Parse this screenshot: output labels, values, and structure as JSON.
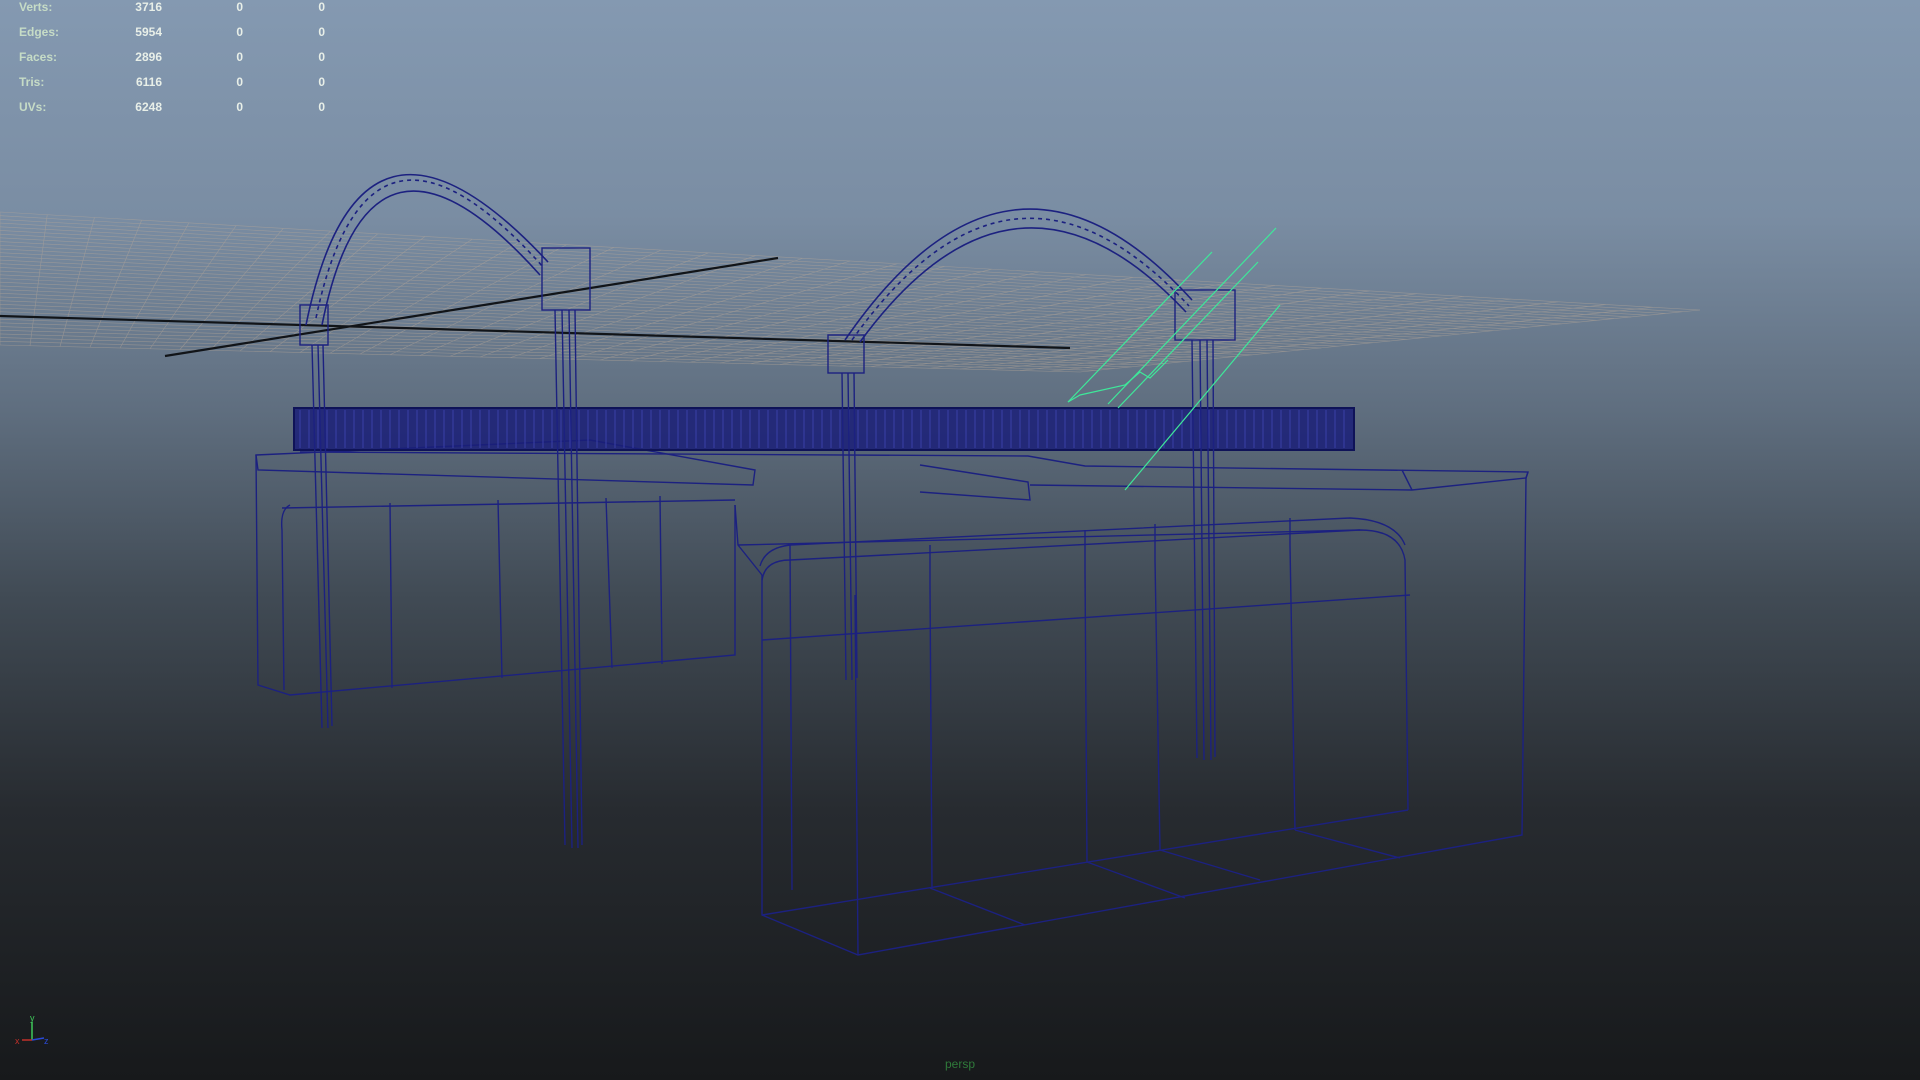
{
  "heads_up_display": {
    "poly_count": [
      {
        "label": "Verts:",
        "values": [
          "3716",
          "0",
          "0"
        ]
      },
      {
        "label": "Edges:",
        "values": [
          "5954",
          "0",
          "0"
        ]
      },
      {
        "label": "Faces:",
        "values": [
          "2896",
          "0",
          "0"
        ]
      },
      {
        "label": "Tris:",
        "values": [
          "6116",
          "0",
          "0"
        ]
      },
      {
        "label": "UVs:",
        "values": [
          "6248",
          "0",
          "0"
        ]
      }
    ]
  },
  "viewport": {
    "camera_name": "persp",
    "display_mode": "wireframe",
    "grid_visible": true
  },
  "axis_gizmo": {
    "y_label": "y",
    "x_label": "x",
    "z_label": "z"
  },
  "colors": {
    "wireframe": "#1a1f78",
    "grid": "#b8a898",
    "selection_highlight": "#3ee89a",
    "hud_text": "#cfe3cf",
    "axis_x": "#c0302a",
    "axis_y": "#3ec85a",
    "axis_z": "#2a4ad8"
  }
}
